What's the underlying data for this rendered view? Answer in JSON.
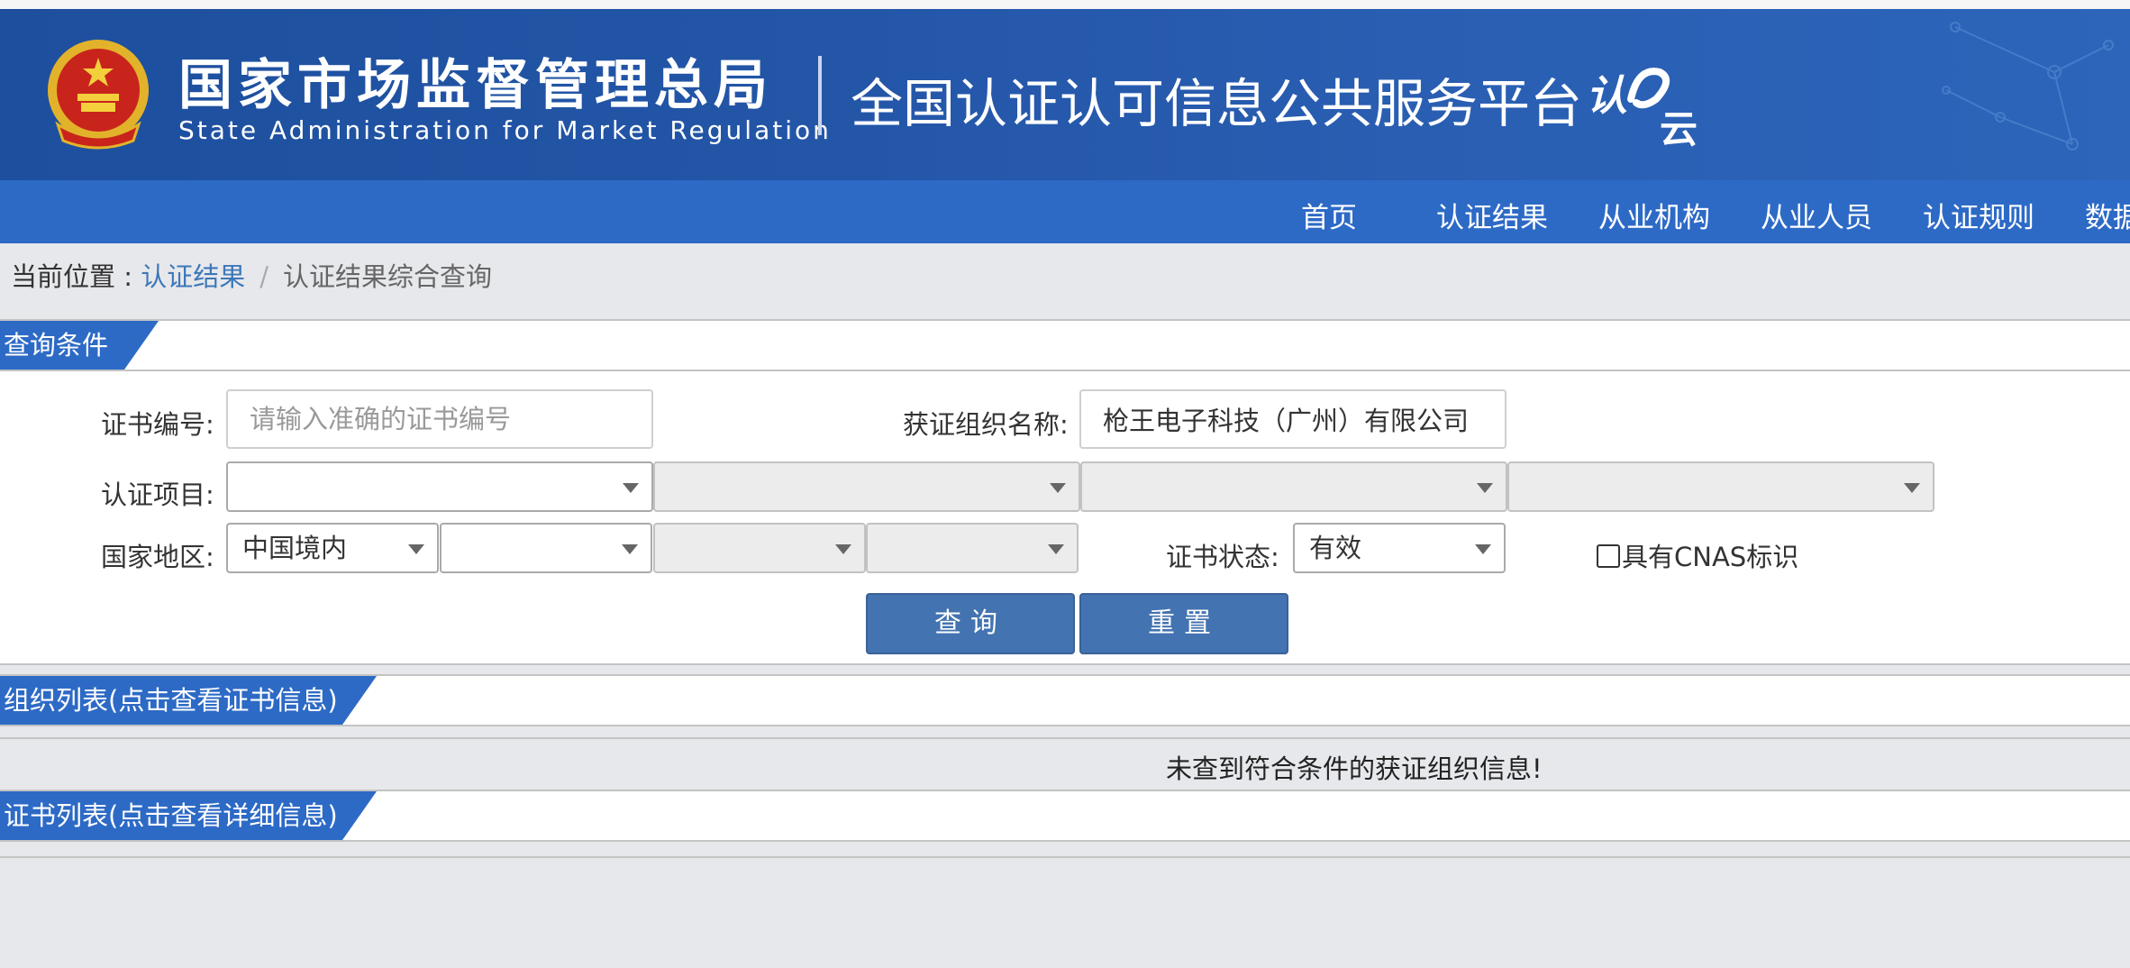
{
  "header": {
    "agency_cn": "国家市场监督管理总局",
    "agency_en": "State Administration  for  Market Regulation",
    "platform_title": "全国认证认可信息公共服务平台",
    "brand_text": "认e云"
  },
  "nav": {
    "items": [
      "首页",
      "认证结果",
      "从业机构",
      "从业人员",
      "认证规则",
      "数据"
    ]
  },
  "breadcrumb": {
    "prefix": "当前位置 : ",
    "link": "认证结果",
    "separator": "/",
    "current": "认证结果综合查询"
  },
  "query_section": {
    "title": "查询条件",
    "cert_no_label": "证书编号:",
    "cert_no_placeholder": "请输入准确的证书编号",
    "org_name_label": "获证组织名称:",
    "org_name_value": "枪王电子科技（广州）有限公司",
    "project_label": "认证项目:",
    "region_label": "国家地区:",
    "region_value": "中国境内",
    "status_label": "证书状态:",
    "status_value": "有效",
    "cnas_label": "具有CNAS标识",
    "search_button": "查询",
    "reset_button": "重置"
  },
  "org_section": {
    "title": "组织列表(点击查看证书信息)",
    "empty_message": "未查到符合条件的获证组织信息!"
  },
  "cert_section": {
    "title": "证书列表(点击查看详细信息)"
  },
  "colors": {
    "header_blue": "#2456a8",
    "nav_blue": "#2d6ac6",
    "button_blue": "#4373b0",
    "link_blue": "#3c78b9",
    "page_bg": "#e7e8ec"
  }
}
